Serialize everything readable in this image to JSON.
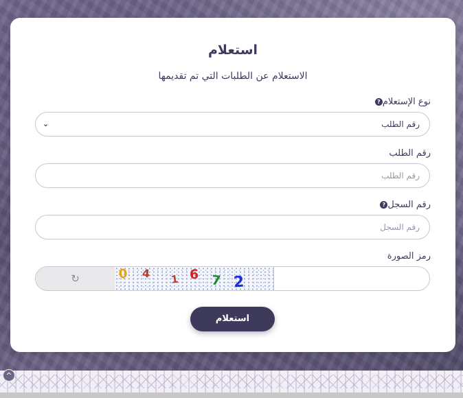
{
  "form": {
    "title": "استعلام",
    "subtitle": "الاستعلام عن الطلبات التي تم تقديمها",
    "inquiry_type": {
      "label": "نوع الإستعلام",
      "selected": "رقم الطلب",
      "help_icon": "question-circle-icon"
    },
    "request_number": {
      "label": "رقم الطلب",
      "placeholder": "رقم الطلب"
    },
    "record_number": {
      "label": "رقم السجل",
      "placeholder": "رقم السجل",
      "help_icon": "question-circle-icon"
    },
    "captcha": {
      "label": "رمز الصورة",
      "code": "041672",
      "refresh_icon": "refresh-icon"
    },
    "submit_label": "استعلام"
  },
  "colors": {
    "primary": "#3d3a5c",
    "border": "#c9c6d3",
    "card": "#ffffff"
  }
}
